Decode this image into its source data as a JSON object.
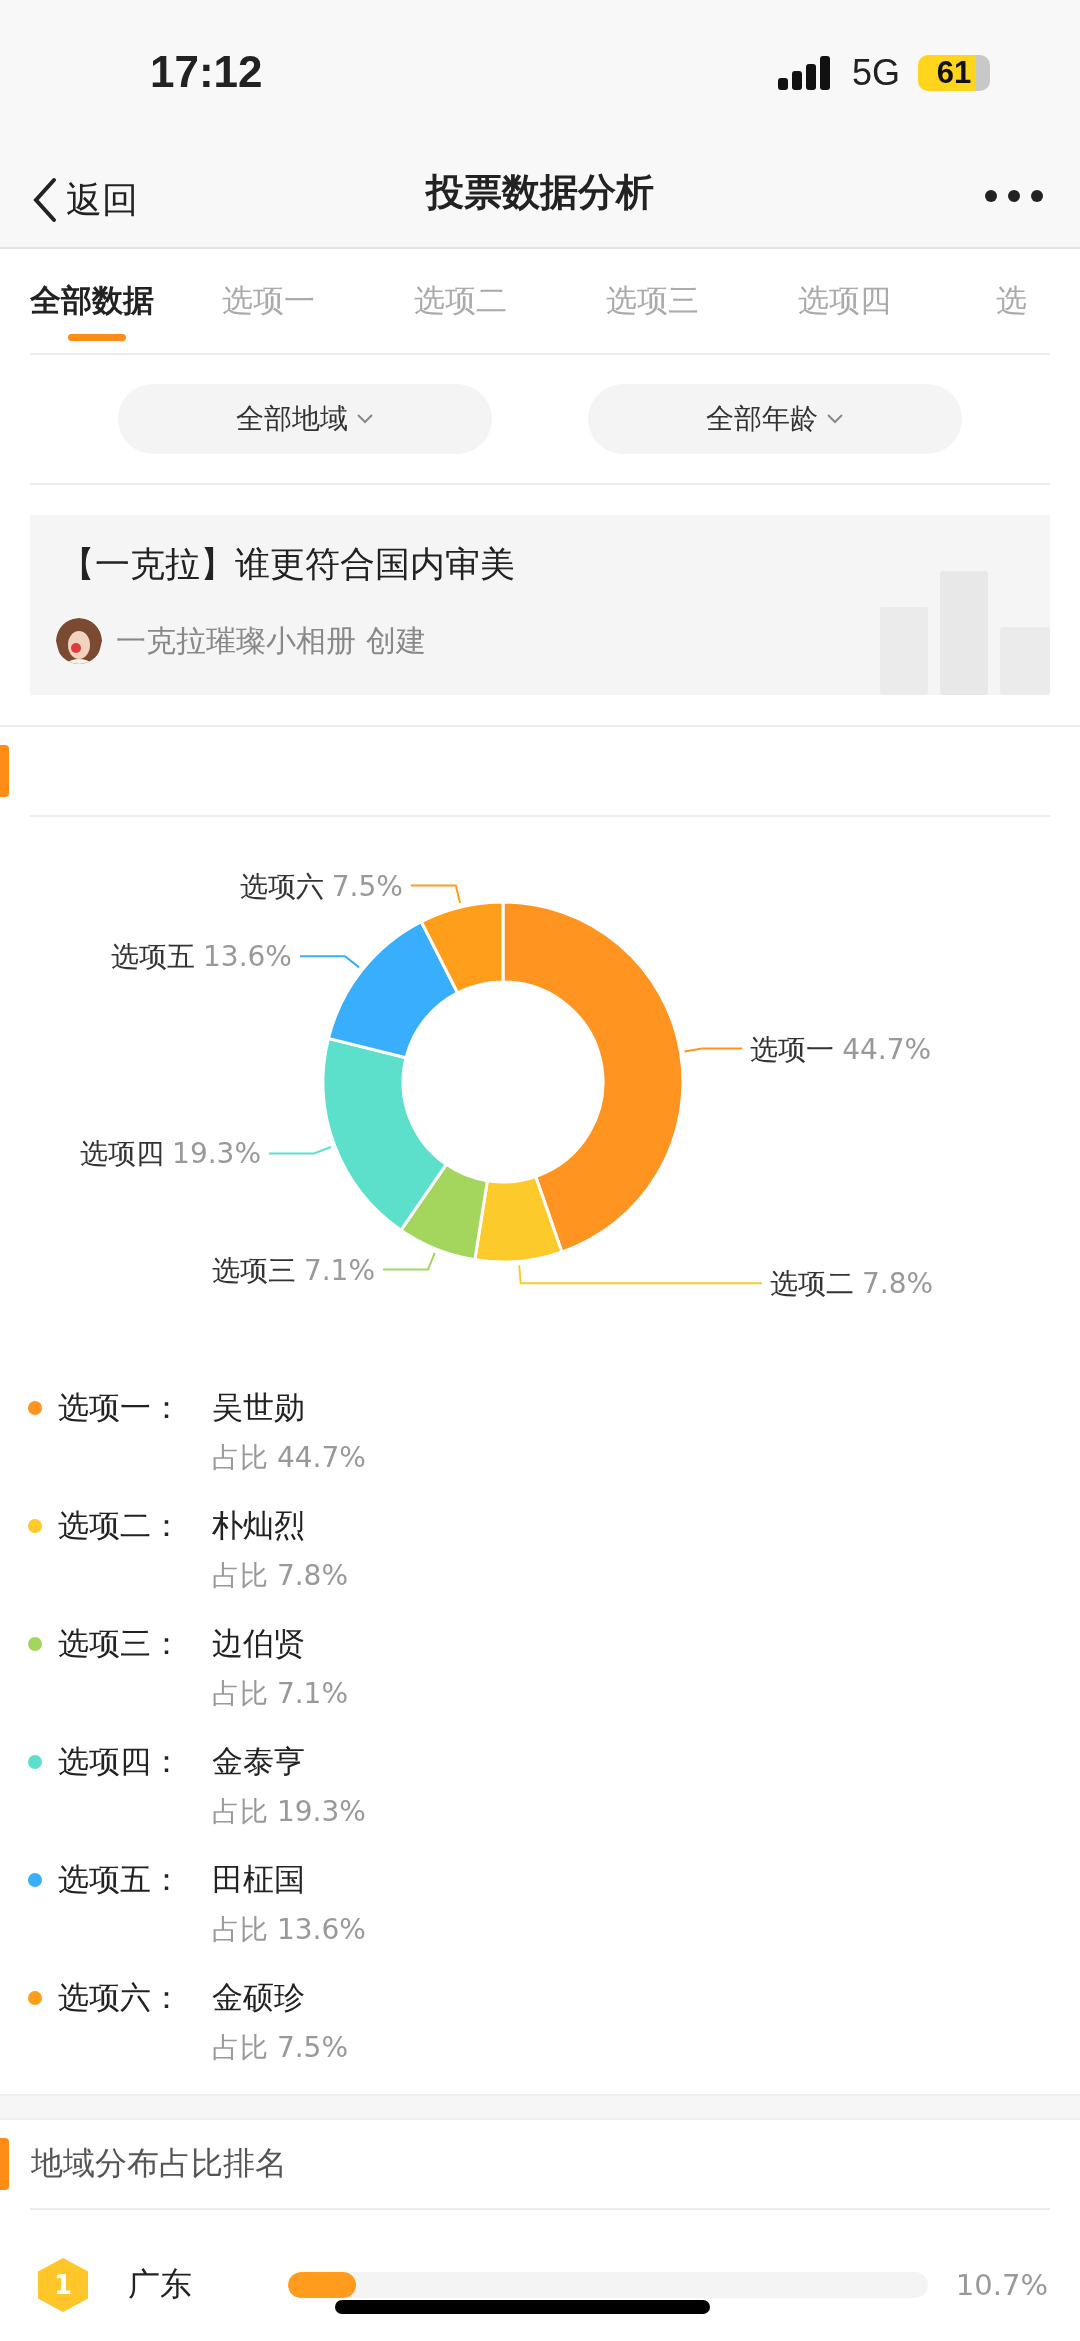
{
  "status_bar": {
    "time": "17:12",
    "network": "5G",
    "battery": "61"
  },
  "nav": {
    "back": "返回",
    "title": "投票数据分析"
  },
  "tabs": [
    {
      "label": "全部数据",
      "selected": true
    },
    {
      "label": "选项一",
      "selected": false
    },
    {
      "label": "选项二",
      "selected": false
    },
    {
      "label": "选项三",
      "selected": false
    },
    {
      "label": "选项四",
      "selected": false
    },
    {
      "label": "选",
      "selected": false
    }
  ],
  "filters": [
    {
      "label": "全部地域"
    },
    {
      "label": "全部年龄"
    }
  ],
  "poll": {
    "title": "【一克拉】谁更符合国内审美",
    "creator": "一克拉璀璨小相册 创建"
  },
  "results": {
    "chart_data": {
      "type": "donut",
      "categories": [
        "选项一",
        "选项二",
        "选项三",
        "选项四",
        "选项五",
        "选项六"
      ],
      "values": [
        44.7,
        7.8,
        7.1,
        19.3,
        13.6,
        7.5
      ],
      "value_labels": [
        "44.7%",
        "7.8%",
        "7.1%",
        "19.3%",
        "13.6%",
        "7.5%"
      ]
    },
    "legend": [
      {
        "option": "选项一：",
        "name": "吴世勋",
        "share": "占比 44.7%",
        "color": "#ff9421"
      },
      {
        "option": "选项二：",
        "name": "朴灿烈",
        "share": "占比 7.8%",
        "color": "#fcca2b"
      },
      {
        "option": "选项三：",
        "name": "边伯贤",
        "share": "占比 7.1%",
        "color": "#a4d65e"
      },
      {
        "option": "选项四：",
        "name": "金泰亨",
        "share": "占比 19.3%",
        "color": "#5ce0cb"
      },
      {
        "option": "选项五：",
        "name": "田柾国",
        "share": "占比 13.6%",
        "color": "#38aefc"
      },
      {
        "option": "选项六：",
        "name": "金硕珍",
        "share": "占比 7.5%",
        "color": "#ff9e1b"
      }
    ]
  },
  "region_ranking": {
    "title": "地域分布占比排名",
    "rows": [
      {
        "rank": "1",
        "region": "广东",
        "level": 0.107,
        "share": "10.7%"
      }
    ]
  }
}
